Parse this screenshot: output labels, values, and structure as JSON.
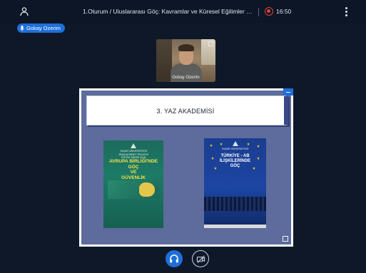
{
  "topbar": {
    "title": "1.Oturum / Uluslararası Göç: Kavramlar ve Küresel Eğilimler - Doç. Dr. G...",
    "recording_time": "16:50",
    "users_icon": "user-icon",
    "menu_icon": "kebab-menu-icon",
    "recording_icon": "record-icon"
  },
  "presenter": {
    "name": "Gokay Ozerim",
    "icon": "microphone-icon"
  },
  "webcam": {
    "label": "Gokay Ozerim"
  },
  "presentation": {
    "slide_title": "3. YAZ AKADEMİSİ",
    "poster_left": {
      "top_text": "YAŞAR ÜNİVERSİTESİ\nJEAN MONNET PROJESİ\nEĞİTİM SERİSİ 2018",
      "heading": "AVRUPA BİRLİĞİ'NDE\nGÖÇ\nVE\nGÜVENLİK"
    },
    "poster_right": {
      "top_text": "YAŞAR ÜNİVERSİTESİ",
      "heading": "TÜRKİYE - AB\nİLİŞKİLERİNDE\nGÖÇ"
    }
  },
  "controls": {
    "audio_icon": "headphones-icon",
    "video_icon": "camera-off-icon"
  },
  "colors": {
    "background": "#0e1829",
    "accent": "#1e6fd9",
    "record": "#e0413c",
    "slide_background": "#5d6c9c"
  }
}
